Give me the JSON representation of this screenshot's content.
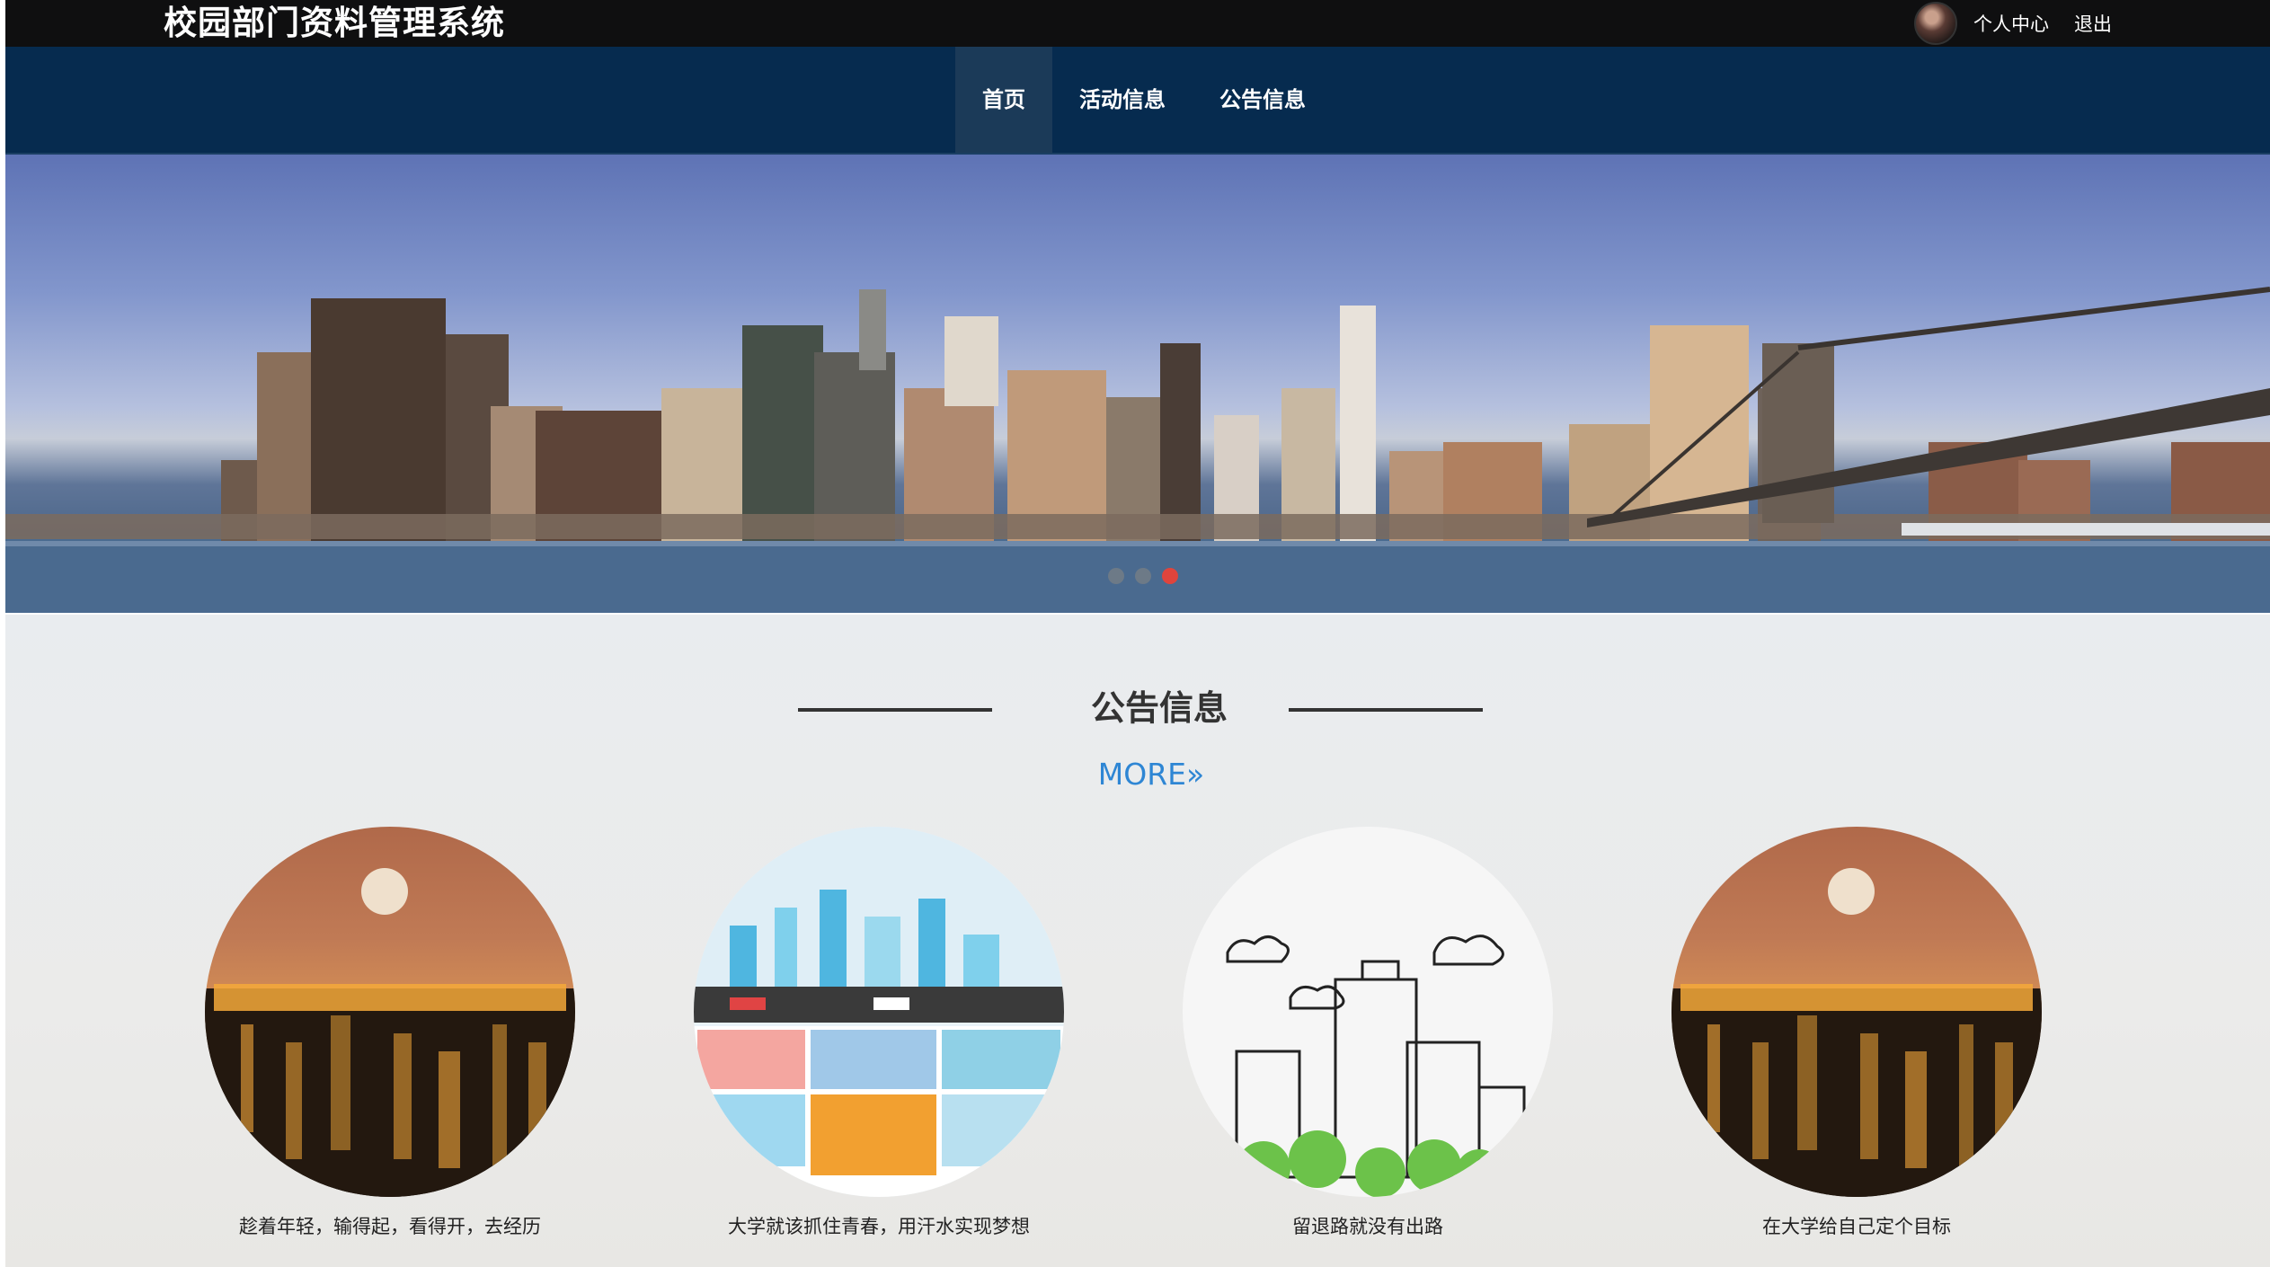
{
  "header": {
    "title": "校园部门资料管理系统",
    "user_center": "个人中心",
    "logout": "退出"
  },
  "nav": {
    "items": [
      {
        "label": "首页",
        "active": true
      },
      {
        "label": "活动信息",
        "active": false
      },
      {
        "label": "公告信息",
        "active": false
      }
    ]
  },
  "banner": {
    "slide_count": 3,
    "active_slide": 3
  },
  "notice_section": {
    "title": "公告信息",
    "more_label": "MORE",
    "more_icon": "double-chevron-right-icon",
    "items": [
      {
        "caption": "趁着年轻，输得起，看得开，去经历",
        "image": "night-city-moon"
      },
      {
        "caption": "大学就该抓住青春，用汗水实现梦想",
        "image": "cartoon-city"
      },
      {
        "caption": "留退路就没有出路",
        "image": "sketch-buildings"
      },
      {
        "caption": "在大学给自己定个目标",
        "image": "night-city-moon"
      }
    ]
  },
  "colors": {
    "topbar": "#0f0f10",
    "nav": "#062b4f",
    "nav_active": "#1b3a58",
    "more_link": "#2e86d4",
    "active_dot": "#e0443c"
  }
}
